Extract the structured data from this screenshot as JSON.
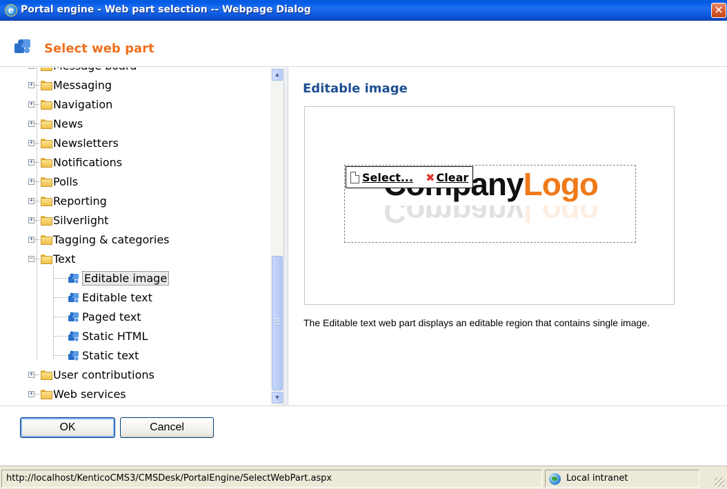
{
  "window": {
    "title": "Portal engine - Web part selection -- Webpage Dialog",
    "ie_icon": "ie-icon",
    "close_label": "✕"
  },
  "header": {
    "title": "Select web part",
    "icon": "puzzle-icon"
  },
  "tree": {
    "partial_top_label": "Message board",
    "categories": [
      {
        "label": "Messaging",
        "expanded": false
      },
      {
        "label": "Navigation",
        "expanded": false
      },
      {
        "label": "News",
        "expanded": false
      },
      {
        "label": "Newsletters",
        "expanded": false
      },
      {
        "label": "Notifications",
        "expanded": false
      },
      {
        "label": "Polls",
        "expanded": false
      },
      {
        "label": "Reporting",
        "expanded": false
      },
      {
        "label": "Silverlight",
        "expanded": false
      },
      {
        "label": "Tagging & categories",
        "expanded": false
      },
      {
        "label": "Text",
        "expanded": true
      },
      {
        "label": "User contributions",
        "expanded": false
      },
      {
        "label": "Web services",
        "expanded": false
      }
    ],
    "text_children": [
      {
        "label": "Editable image",
        "selected": true
      },
      {
        "label": "Editable text",
        "selected": false
      },
      {
        "label": "Paged text",
        "selected": false
      },
      {
        "label": "Static HTML",
        "selected": false
      },
      {
        "label": "Static text",
        "selected": false
      }
    ],
    "expander_collapsed": "+",
    "expander_expanded": "−"
  },
  "preview": {
    "title": "Editable image",
    "logo_company": "Company",
    "logo_logo": "Logo",
    "toolbar": {
      "select_label": "Select...",
      "clear_label": "Clear",
      "clear_icon": "✖"
    },
    "description": "The Editable text web part displays an editable region that contains single image."
  },
  "buttons": {
    "ok_label": "OK",
    "cancel_label": "Cancel"
  },
  "statusbar": {
    "url": "http://localhost/KenticoCMS3/CMSDesk/PortalEngine/SelectWebPart.aspx",
    "zone": "Local intranet"
  },
  "colors": {
    "title_bar": "#0a53d8",
    "header_title": "#f06f1d",
    "web_part_title": "#1d4f91",
    "logo_orange": "#f07a1a"
  }
}
